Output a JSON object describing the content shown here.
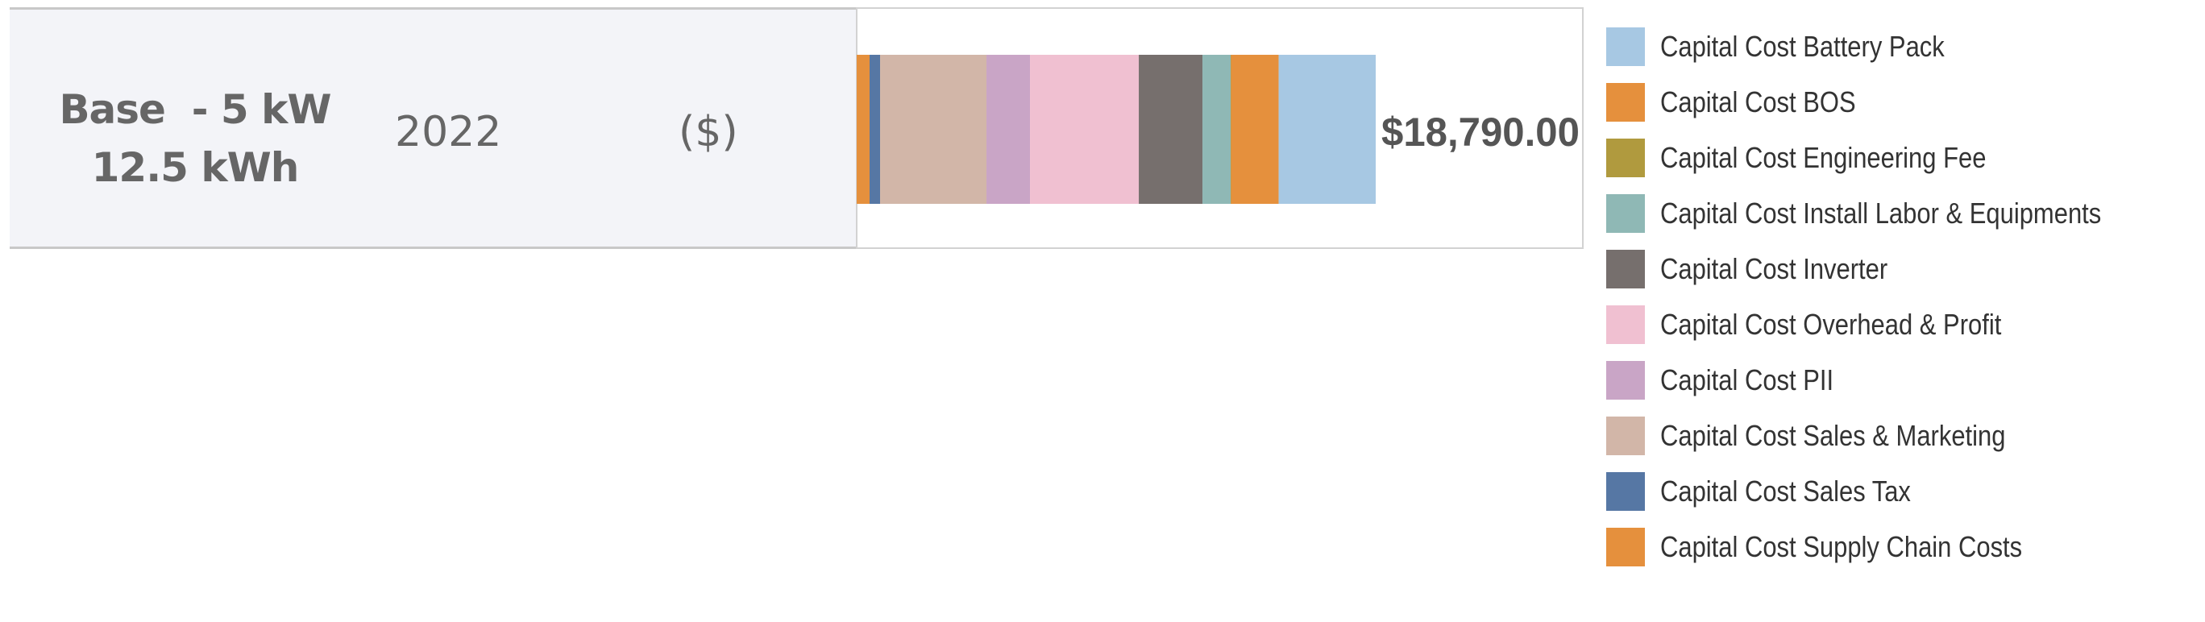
{
  "header": {
    "config_line1": "Base  - 5 kW",
    "config_line2": "12.5 kWh",
    "year": "2022",
    "unit": "($)"
  },
  "chart_data": {
    "type": "bar",
    "orientation": "horizontal-stacked",
    "title": "",
    "xlabel": "",
    "ylabel": "",
    "grid": false,
    "legend_position": "right",
    "categories": [
      "Base - 5 kW 12.5 kWh | 2022 | ($)"
    ],
    "xlim": [
      0,
      22600
    ],
    "total_label": "$18,790.00",
    "total": 18790,
    "stack_order": [
      "Capital Cost Supply Chain Costs",
      "Capital Cost Sales Tax",
      "Capital Cost Sales & Marketing",
      "Capital Cost PII",
      "Capital Cost Overhead & Profit",
      "Capital Cost Inverter",
      "Capital Cost Install Labor & Equipments",
      "Capital Cost Engineering Fee",
      "Capital Cost BOS",
      "Capital Cost Battery Pack"
    ],
    "series": [
      {
        "name": "Capital Cost Battery Pack",
        "color": "#a7c8e3",
        "values": [
          3514
        ]
      },
      {
        "name": "Capital Cost BOS",
        "color": "#e5903d",
        "values": [
          1722
        ]
      },
      {
        "name": "Capital Cost Engineering Fee",
        "color": "#b09a3e",
        "values": [
          15
        ]
      },
      {
        "name": "Capital Cost Install Labor & Equipments",
        "color": "#8fb8b5",
        "values": [
          1021
        ]
      },
      {
        "name": "Capital Cost Inverter",
        "color": "#766f6d",
        "values": [
          2305
        ]
      },
      {
        "name": "Capital Cost Overhead & Profit",
        "color": "#f0c0d1",
        "values": [
          3939
        ]
      },
      {
        "name": "Capital Cost PII",
        "color": "#c9a5c6",
        "values": [
          1576
        ]
      },
      {
        "name": "Capital Cost Sales & Marketing",
        "color": "#d2b6a8",
        "values": [
          3852
        ]
      },
      {
        "name": "Capital Cost Sales Tax",
        "color": "#5677a4",
        "values": [
          379
        ]
      },
      {
        "name": "Capital Cost Supply Chain Costs",
        "color": "#e5903d",
        "values": [
          467
        ]
      }
    ]
  },
  "legend": {
    "items": [
      {
        "label": "Capital Cost Battery Pack",
        "color": "#a7c8e3"
      },
      {
        "label": "Capital Cost BOS",
        "color": "#e5903d"
      },
      {
        "label": "Capital Cost Engineering Fee",
        "color": "#b09a3e"
      },
      {
        "label": "Capital Cost Install Labor & Equipments",
        "color": "#8fb8b5"
      },
      {
        "label": "Capital Cost Inverter",
        "color": "#766f6d"
      },
      {
        "label": "Capital Cost Overhead & Profit",
        "color": "#f0c0d1"
      },
      {
        "label": "Capital Cost PII",
        "color": "#c9a5c6"
      },
      {
        "label": "Capital Cost Sales & Marketing",
        "color": "#d2b6a8"
      },
      {
        "label": "Capital Cost Sales Tax",
        "color": "#5677a4"
      },
      {
        "label": "Capital Cost Supply Chain Costs",
        "color": "#e5903d"
      }
    ]
  }
}
